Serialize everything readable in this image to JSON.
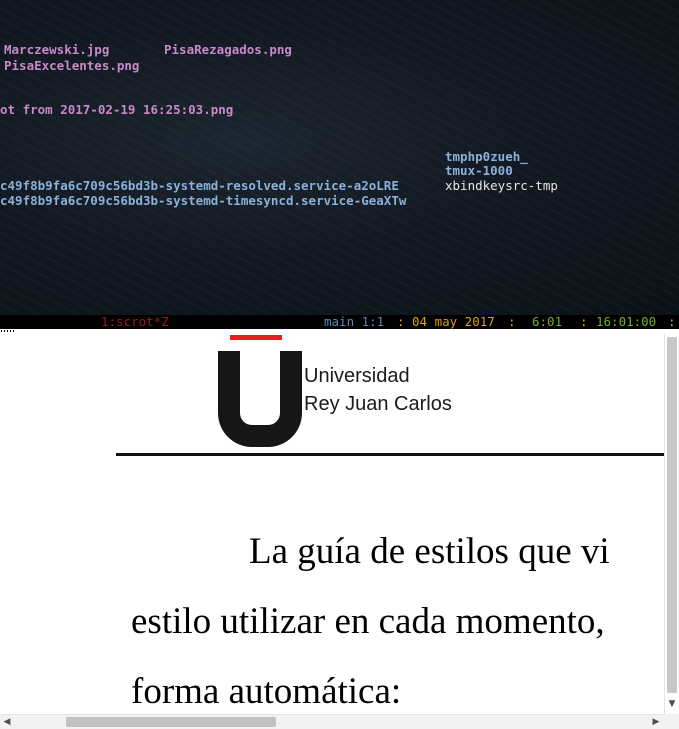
{
  "terminal": {
    "files": {
      "marczewski": "Marczewski.jpg",
      "pisa_rezagados": "PisaRezagados.png",
      "pisa_excelentes": "PisaExcelentes.png",
      "screenshot": "ot from 2017-02-19 16:25:03.png",
      "tmphp": "tmphp0zueh_",
      "tmux": "tmux-1000",
      "systemd_resolved": "c49f8b9fa6c709c56bd3b-systemd-resolved.service-a2oLRE",
      "xbindkeys": "xbindkeysrc-tmp",
      "systemd_timesyncd": "c49f8b9fa6c709c56bd3b-systemd-timesyncd.service-GeaXTw"
    }
  },
  "statusbar": {
    "window": "1:scrot*Z",
    "session": "main 1:1",
    "sep": ":",
    "date": "04 may 2017",
    "uptime": "6:01",
    "clock": "16:01:00",
    "colors": {
      "window": "#9b1c1c",
      "session": "#5d86b8",
      "date": "#d9a300",
      "time": "#6fae2e"
    }
  },
  "document": {
    "logo": {
      "line1": "Universidad",
      "line2": "Rey Juan Carlos",
      "accent_color": "#e2211c"
    },
    "lines": [
      "La guía de estilos que vi",
      "estilo utilizar en cada momento,",
      "forma automática:"
    ]
  },
  "scrollbars": {
    "down_arrow_icon": "triangle-down-icon",
    "left_arrow_icon": "triangle-left-icon",
    "right_arrow_icon": "triangle-right-icon"
  }
}
